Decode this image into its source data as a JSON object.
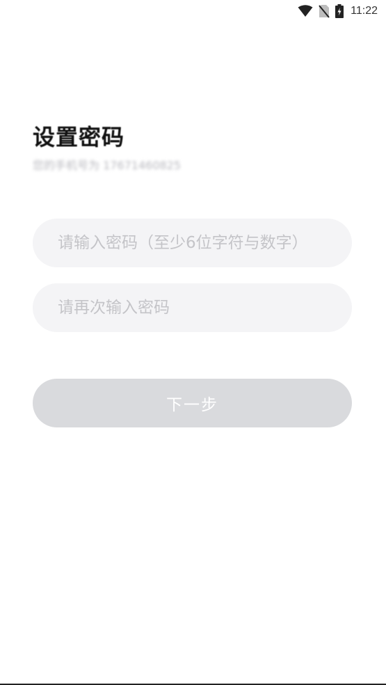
{
  "status_bar": {
    "time": "11:22",
    "icons": [
      "wifi-icon",
      "no-sim-icon",
      "battery-charging-icon"
    ]
  },
  "header": {
    "title": "设置密码",
    "subtitle": "您的手机号为 17671460825"
  },
  "form": {
    "password_placeholder": "请输入密码（至少6位字符与数字）",
    "confirm_placeholder": "请再次输入密码",
    "next_label": "下一步"
  },
  "colors": {
    "field_bg": "#f4f4f6",
    "button_disabled_bg": "#d9dadd",
    "placeholder": "#c4c4c8"
  }
}
